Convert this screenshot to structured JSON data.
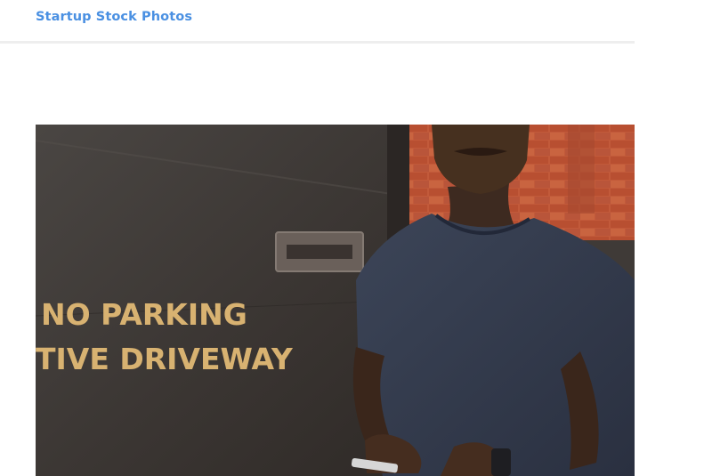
{
  "header": {
    "site_title": "Startup Stock Photos"
  },
  "hero": {
    "sign_line_1": "NO PARKING",
    "sign_line_2": "TIVE DRIVEWAY",
    "brand_color": "#4a90e2"
  }
}
